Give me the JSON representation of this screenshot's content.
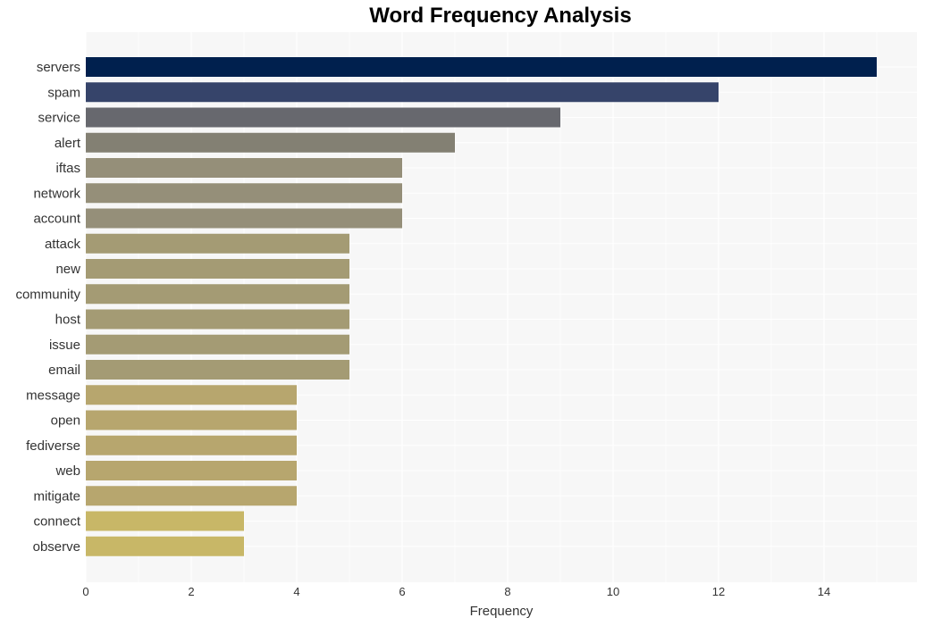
{
  "chart_data": {
    "type": "bar",
    "orientation": "horizontal",
    "title": "Word Frequency Analysis",
    "xlabel": "Frequency",
    "ylabel": "",
    "xlim": [
      0,
      15.8
    ],
    "xticks": [
      0,
      2,
      4,
      6,
      8,
      10,
      12,
      14
    ],
    "grid": true,
    "categories": [
      "servers",
      "spam",
      "service",
      "alert",
      "iftas",
      "network",
      "account",
      "attack",
      "new",
      "community",
      "host",
      "issue",
      "email",
      "message",
      "open",
      "fediverse",
      "web",
      "mitigate",
      "connect",
      "observe"
    ],
    "values": [
      15,
      12,
      9,
      7,
      6,
      6,
      6,
      5,
      5,
      5,
      5,
      5,
      5,
      4,
      4,
      4,
      4,
      4,
      3,
      3
    ],
    "colors": [
      "#00204e",
      "#36446a",
      "#67686e",
      "#838073",
      "#958f79",
      "#958f79",
      "#958f79",
      "#a49b74",
      "#a49b74",
      "#a49b74",
      "#a49b74",
      "#a49b74",
      "#a49b74",
      "#b7a66e",
      "#b7a66e",
      "#b7a66e",
      "#b7a66e",
      "#b7a66e",
      "#c8b767",
      "#c8b767"
    ]
  }
}
